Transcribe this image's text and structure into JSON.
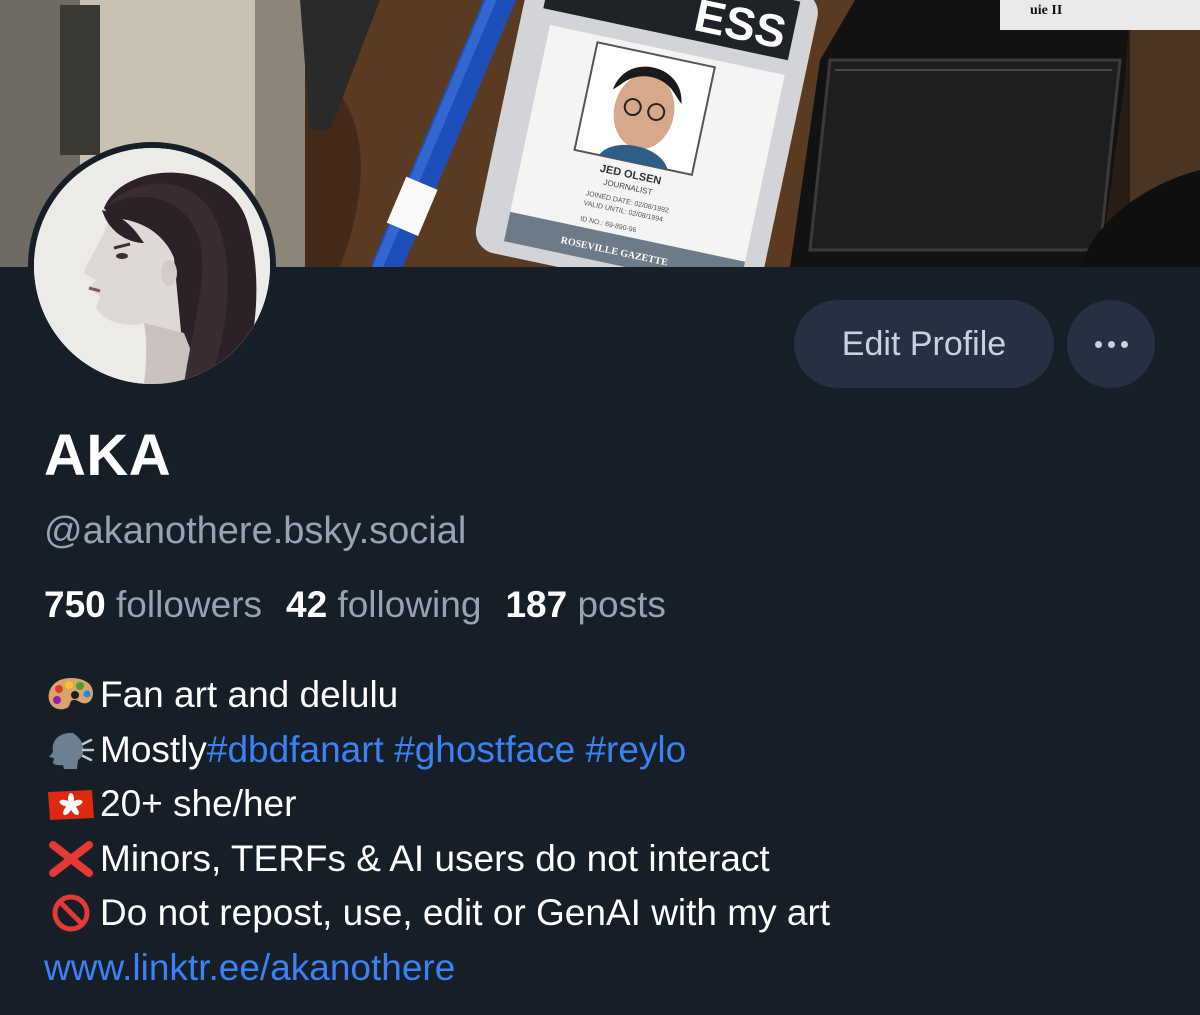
{
  "profile": {
    "display_name": "AKA",
    "handle": "@akanothere.bsky.social"
  },
  "stats": {
    "followers_count": "750",
    "followers_label": "followers",
    "following_count": "42",
    "following_label": "following",
    "posts_count": "187",
    "posts_label": "posts"
  },
  "actions": {
    "edit_profile_label": "Edit Profile",
    "more_icon": "ellipsis-icon"
  },
  "banner": {
    "press_card_header": "ESS",
    "press_card_name": "JED OLSEN",
    "press_card_role": "JOURNALIST",
    "press_card_joined": "JOINED DATE: 02/08/1992",
    "press_card_valid": "VALID UNTIL: 02/08/1994",
    "press_card_id": "ID NO.: 69-890-96",
    "press_card_org": "ROSEVILLE GAZETTE",
    "corner_text": "uie II"
  },
  "bio": {
    "line1_icon": "artist-palette-icon",
    "line1_text": "Fan art and delulu",
    "line2_icon": "speaking-head-icon",
    "line2_text": "Mostly ",
    "line2_tag1": "#dbdfanart",
    "line2_tag2": "#ghostface",
    "line2_tag3": "#reylo",
    "line3_icon": "hong-kong-flag-icon",
    "line3_text": "20+ she/her",
    "line4_icon": "cross-mark-icon",
    "line4_text": "Minors, TERFs & AI users do not interact",
    "line5_icon": "prohibited-icon",
    "line5_text": "Do not repost, use, edit or GenAI with my art",
    "link": "www.linktr.ee/akanothere"
  },
  "colors": {
    "background": "#161e27",
    "button_bg": "#253142",
    "link": "#3b82f6",
    "muted": "#96a3b3"
  }
}
